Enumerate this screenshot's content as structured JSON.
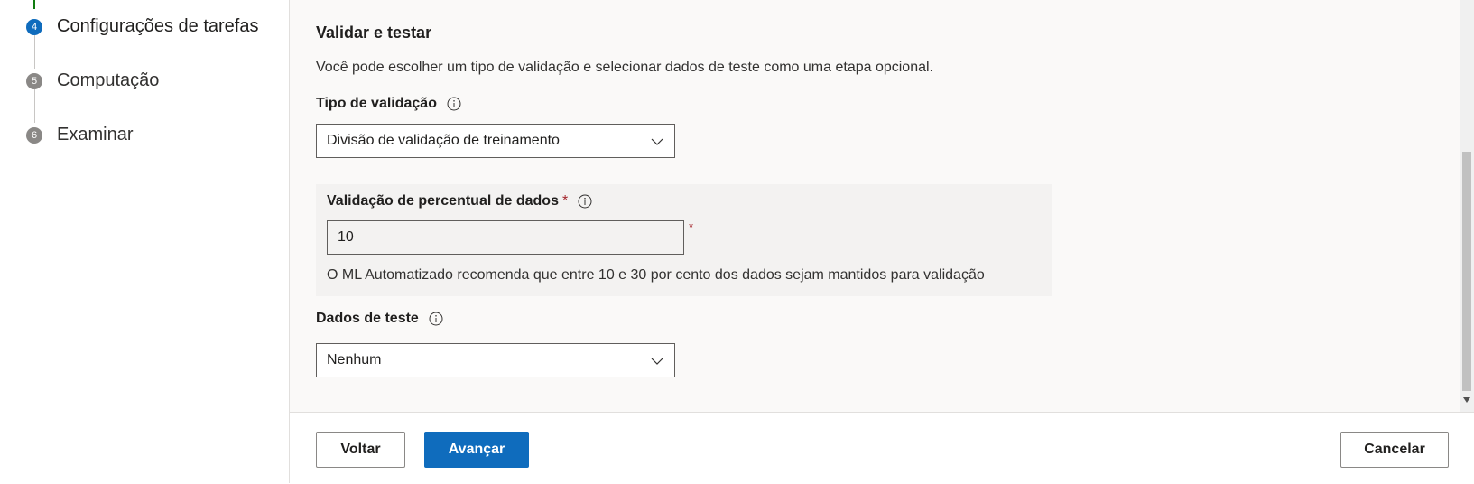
{
  "steps": [
    {
      "number": "4",
      "label": "Configurações de tarefas",
      "active": true
    },
    {
      "number": "5",
      "label": "Computação",
      "active": false
    },
    {
      "number": "6",
      "label": "Examinar",
      "active": false
    }
  ],
  "section": {
    "title": "Validar e testar",
    "description": "Você pode escolher um tipo de validação e selecionar dados de teste como uma etapa opcional."
  },
  "validation_type": {
    "label": "Tipo de validação",
    "value": "Divisão de validação de treinamento"
  },
  "validation_percent": {
    "label": "Validação de percentual de dados",
    "required_mark": "*",
    "value": "10",
    "hint": "O ML Automatizado recomenda que entre 10 e 30 por cento dos dados sejam mantidos para validação"
  },
  "test_data": {
    "label": "Dados de teste",
    "value": "Nenhum"
  },
  "footer": {
    "back_label": "Voltar",
    "next_label": "Avançar",
    "cancel_label": "Cancelar"
  },
  "colors": {
    "accent": "#0f6cbd",
    "completed": "#107c10",
    "required": "#a4262c"
  },
  "icons": {
    "info": "info-icon",
    "chevron": "chevron-down-icon"
  }
}
